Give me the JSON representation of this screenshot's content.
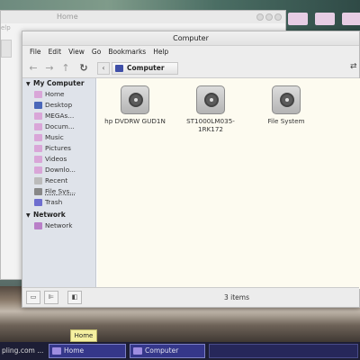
{
  "back_window": {
    "title": "Home",
    "menu_partial": "elp"
  },
  "window": {
    "title": "Computer",
    "menu": [
      "File",
      "Edit",
      "View",
      "Go",
      "Bookmarks",
      "Help"
    ],
    "location": "Computer"
  },
  "sidebar": {
    "sections": [
      {
        "title": "My Computer",
        "items": [
          {
            "label": "Home",
            "icon": "home-icon",
            "color": "#d9a6d8"
          },
          {
            "label": "Desktop",
            "icon": "desktop-icon",
            "color": "#4a67b9"
          },
          {
            "label": "MEGAs...",
            "icon": "folder-icon",
            "color": "#d9a6d8"
          },
          {
            "label": "Docum...",
            "icon": "folder-icon",
            "color": "#d9a6d8"
          },
          {
            "label": "Music",
            "icon": "music-icon",
            "color": "#d9a6d8"
          },
          {
            "label": "Pictures",
            "icon": "pictures-icon",
            "color": "#d9a6d8"
          },
          {
            "label": "Videos",
            "icon": "videos-icon",
            "color": "#d9a6d8"
          },
          {
            "label": "Downlo...",
            "icon": "downloads-icon",
            "color": "#d9a6d8"
          },
          {
            "label": "Recent",
            "icon": "recent-icon",
            "color": "#bbbbbb"
          },
          {
            "label": "File Sys...",
            "icon": "drive-icon",
            "color": "#888888"
          },
          {
            "label": "Trash",
            "icon": "trash-icon",
            "color": "#6e6ecf"
          }
        ]
      },
      {
        "title": "Network",
        "items": [
          {
            "label": "Network",
            "icon": "network-icon",
            "color": "#b97fc8"
          }
        ]
      }
    ]
  },
  "devices": [
    {
      "label": "hp     DVDRW GUD1N",
      "icon": "optical-drive-icon"
    },
    {
      "label": "ST1000LM035-1RK172",
      "icon": "hard-disk-icon"
    },
    {
      "label": "File System",
      "icon": "hard-disk-icon"
    }
  ],
  "status": {
    "items": "3 items"
  },
  "taskbar": {
    "left_text": "pling.com ...",
    "tasks": [
      {
        "label": "Home"
      },
      {
        "label": "Computer"
      }
    ],
    "tooltip": "Home"
  }
}
